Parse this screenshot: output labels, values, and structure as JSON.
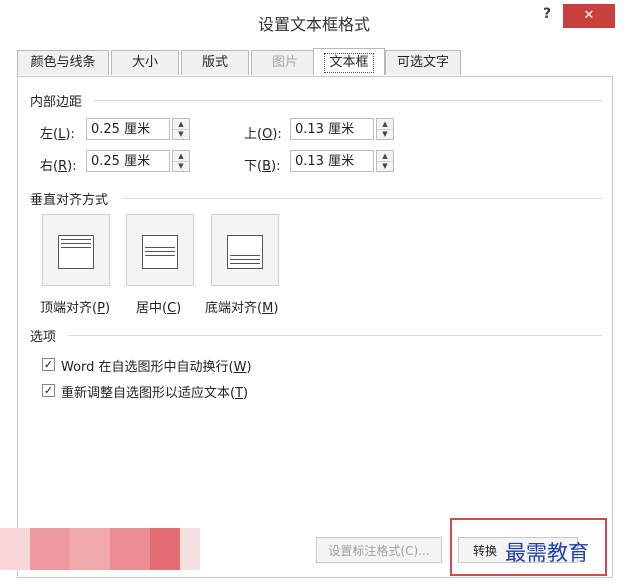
{
  "window": {
    "title": "设置文本框格式",
    "help_label": "?",
    "close_label": "✕"
  },
  "tabs": [
    {
      "label": "颜色与线条",
      "state": "normal"
    },
    {
      "label": "大小",
      "state": "normal"
    },
    {
      "label": "版式",
      "state": "normal"
    },
    {
      "label": "图片",
      "state": "disabled"
    },
    {
      "label": "文本框",
      "state": "active"
    },
    {
      "label": "可选文字",
      "state": "normal"
    }
  ],
  "internal_margin": {
    "section_title": "内部边距",
    "left": {
      "label": "左",
      "key": "L",
      "value": "0.25 厘米"
    },
    "right": {
      "label": "右",
      "key": "R",
      "value": "0.25 厘米"
    },
    "top": {
      "label": "上",
      "key": "O",
      "value": "0.13 厘米"
    },
    "bottom": {
      "label": "下",
      "key": "B",
      "value": "0.13 厘米"
    },
    "spinner_up": "▲",
    "spinner_down": "▼"
  },
  "vertical_alignment": {
    "section_title": "垂直对齐方式",
    "options": [
      {
        "label": "顶端对齐",
        "key": "P",
        "icon": "align-top-icon"
      },
      {
        "label": "居中",
        "key": "C",
        "icon": "align-middle-icon"
      },
      {
        "label": "底端对齐",
        "key": "M",
        "icon": "align-bottom-icon"
      }
    ]
  },
  "options": {
    "section_title": "选项",
    "items": [
      {
        "label": "Word 在自选图形中自动换行",
        "key": "W",
        "checked": true
      },
      {
        "label": "重新调整自选图形以适应文本",
        "key": "T",
        "checked": true
      }
    ]
  },
  "buttons": {
    "callout_format": "设置标注格式(C)...",
    "convert": "转换"
  },
  "watermark": "最需教育",
  "colors": {
    "close_button": "#c8403b",
    "highlight_border": "#d04a4a",
    "watermark": "#1e3ea8"
  }
}
